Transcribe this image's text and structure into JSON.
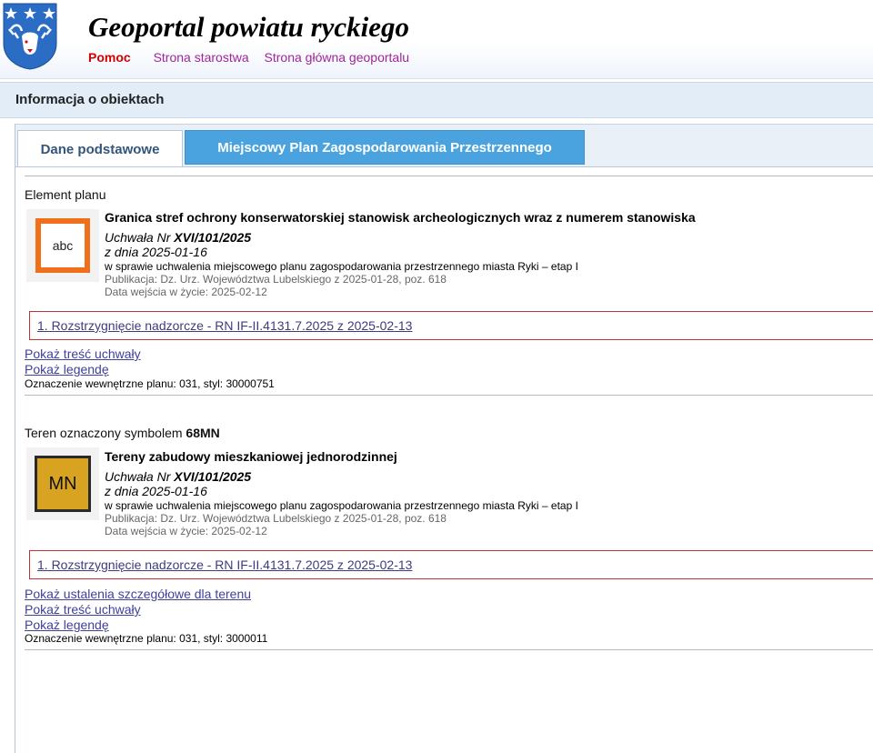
{
  "header": {
    "title": "Geoportal powiatu ryckiego",
    "links": [
      {
        "label": "Pomoc"
      },
      {
        "label": "Strona starostwa"
      },
      {
        "label": "Strona główna geoportalu"
      }
    ]
  },
  "infobar": {
    "title": "Informacja o obiektach"
  },
  "tabs": [
    {
      "label": "Dane podstawowe",
      "active": true
    },
    {
      "label": "Miejscowy Plan Zagospodarowania Przestrzennego",
      "active": false
    }
  ],
  "sections": [
    {
      "label_prefix": "Element planu",
      "label_bold": "",
      "symbol_text": "abc",
      "title": "Granica stref ochrony konserwatorskiej stanowisk archeologicznych wraz z numerem stanowiska",
      "resolution_prefix": "Uchwała Nr ",
      "resolution_number": "XVI/101/2025",
      "date": "z dnia 2025-01-16",
      "subject": "w sprawie uchwalenia miejscowego planu zagospodarowania przestrzennego miasta Ryki – etap I",
      "publication": "Publikacja: Dz. Urz. Województwa Lubelskiego z 2025-01-28, poz. 618",
      "effective": "Data wejścia w życie: 2025-02-12",
      "rn_link": "1. Rozstrzygnięcie nadzorcze - RN IF-II.4131.7.2025 z 2025-02-13",
      "links": [
        "Pokaż treść uchwały",
        "Pokaż legendę"
      ],
      "note": "Oznaczenie wewnętrzne planu: 031, styl: 30000751"
    },
    {
      "label_prefix": "Teren oznaczony symbolem ",
      "label_bold": "68MN",
      "symbol_text": "MN",
      "title": "Tereny zabudowy mieszkaniowej jednorodzinnej",
      "resolution_prefix": "Uchwała Nr ",
      "resolution_number": "XVI/101/2025",
      "date": "z dnia 2025-01-16",
      "subject": "w sprawie uchwalenia miejscowego planu zagospodarowania przestrzennego miasta Ryki – etap I",
      "publication": "Publikacja: Dz. Urz. Województwa Lubelskiego z 2025-01-28, poz. 618",
      "effective": "Data wejścia w życie: 2025-02-12",
      "rn_link": "1. Rozstrzygnięcie nadzorcze - RN IF-II.4131.7.2025 z 2025-02-13",
      "links": [
        "Pokaż ustalenia szczegółowe dla terenu",
        "Pokaż treść uchwały",
        "Pokaż legendę"
      ],
      "note": "Oznaczenie wewnętrzne planu: 031, styl: 3000011"
    }
  ],
  "colors": {
    "header_link": "#a0269a",
    "help_link": "#d40000",
    "active_tab_text": "#33557b",
    "inactive_tab_bg": "#4aa3de",
    "rn_border": "#c13338",
    "symbol_abc": "#ef6f1a",
    "symbol_mn": "#d9a322"
  }
}
